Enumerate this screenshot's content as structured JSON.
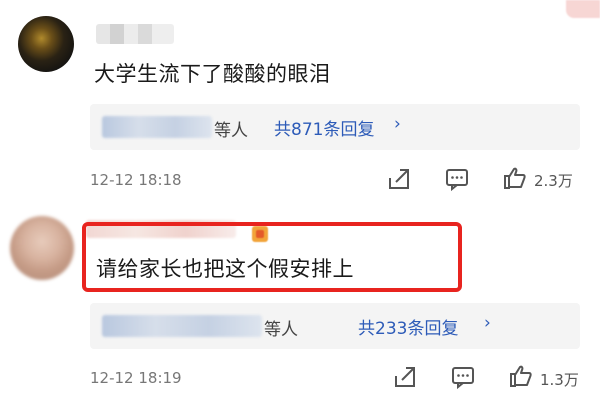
{
  "comments": [
    {
      "text": "大学生流下了酸酸的眼泪",
      "reply_prefix": "等人",
      "reply_link": "共871条回复",
      "reply_chevron": "›",
      "date": "12-12 18:18",
      "likes": "2.3万"
    },
    {
      "text": "请给家长也把这个假安排上",
      "reply_prefix": "等人",
      "reply_link": "共233条回复",
      "reply_chevron": "›",
      "date": "12-12 18:19",
      "likes": "1.3万"
    }
  ],
  "colors": {
    "highlight": "#e8241f",
    "link": "#2d5bb8"
  },
  "icons": [
    "share-icon",
    "comment-icon",
    "like-icon"
  ]
}
